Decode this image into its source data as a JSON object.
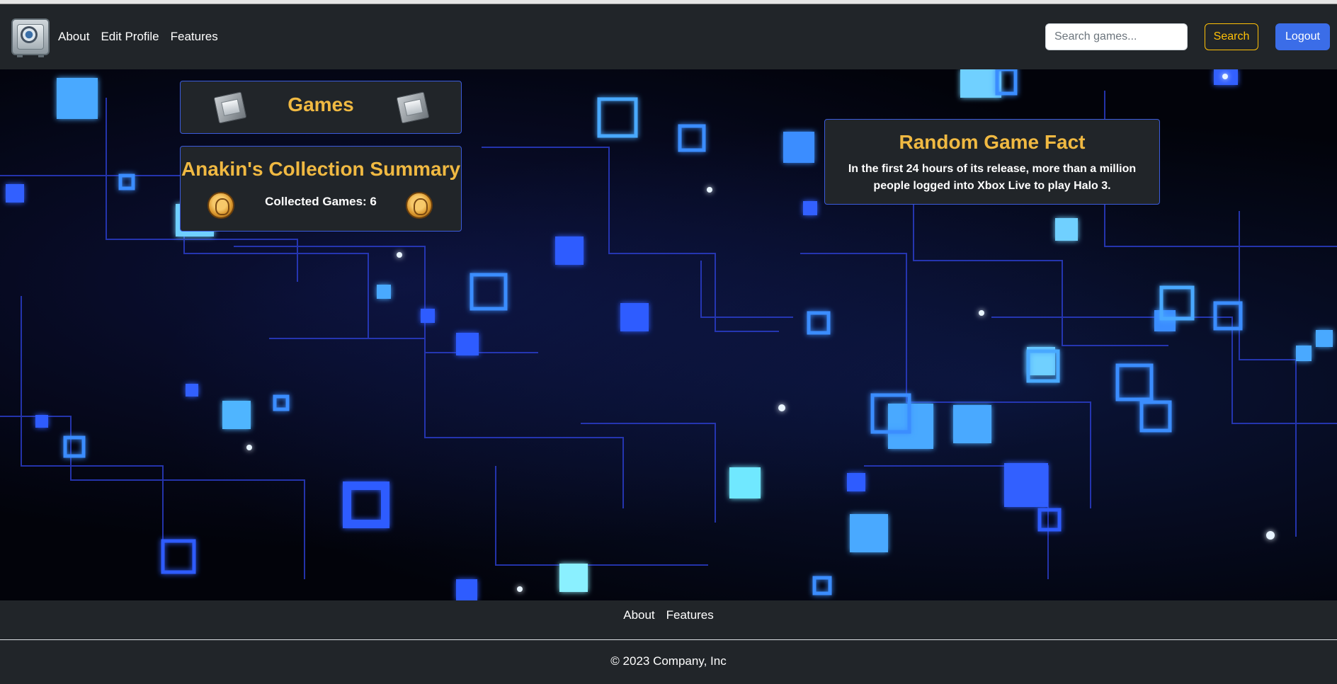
{
  "nav": {
    "links": [
      "About",
      "Edit Profile",
      "Features"
    ],
    "search_placeholder": "Search games...",
    "search_label": "Search",
    "logout_label": "Logout"
  },
  "games_card": {
    "title": "Games"
  },
  "summary_card": {
    "title": "Anakin's Collection Summary",
    "count_text": "Collected Games: 6"
  },
  "fact_card": {
    "title": "Random Game Fact",
    "text": "In the first 24 hours of its release, more than a million people logged into Xbox Live to play Halo 3."
  },
  "footer": {
    "links": [
      "About",
      "Features"
    ],
    "copyright": "© 2023 Company, Inc"
  },
  "colors": {
    "accent": "#f0b942",
    "primary": "#3b6de8",
    "card_border": "#3b5bdb",
    "dark": "#212529"
  }
}
